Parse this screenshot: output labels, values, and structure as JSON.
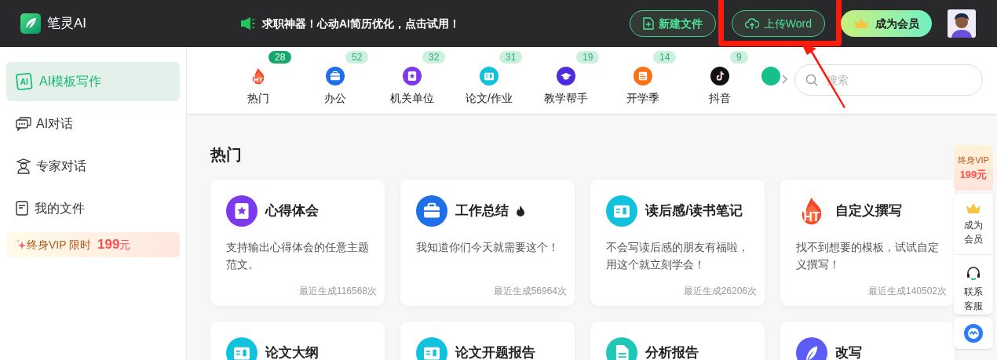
{
  "header": {
    "logo_text": "笔灵AI",
    "promo": "求职神器！心动AI简历优化，点击试用！",
    "buttons": [
      {
        "label": "新建文件",
        "kind": "new",
        "highlighted": false
      },
      {
        "label": "上传Word",
        "kind": "upload",
        "highlighted": true
      },
      {
        "label": "成为会员",
        "kind": "vip",
        "highlighted": false
      }
    ]
  },
  "sidebar": {
    "items": [
      {
        "label": "AI模板写作",
        "icon_text": "AI",
        "selected": true
      },
      {
        "label": "AI对话",
        "selected": false
      },
      {
        "label": "专家对话",
        "selected": false
      },
      {
        "label": "我的文件",
        "selected": false
      }
    ],
    "vip": {
      "label": "终身VIP 限时",
      "price": "199",
      "unit": "元"
    }
  },
  "categories": [
    {
      "label": "热门",
      "count": "28",
      "icon_text": "HT",
      "selected": true
    },
    {
      "label": "办公",
      "count": "52",
      "selected": false
    },
    {
      "label": "机关单位",
      "count": "32",
      "selected": false
    },
    {
      "label": "论文/作业",
      "count": "31",
      "selected": false
    },
    {
      "label": "教学帮手",
      "count": "19",
      "selected": false
    },
    {
      "label": "开学季",
      "count": "14",
      "selected": false
    },
    {
      "label": "抖音",
      "count": "9",
      "selected": false
    }
  ],
  "search": {
    "placeholder": "搜索"
  },
  "section_title": "热门",
  "cards": [
    {
      "title": "心得体会",
      "desc": "支持输出心得体会的任意主题范文。",
      "count": "最近生成116568次",
      "flame": false
    },
    {
      "title": "工作总结",
      "desc": "我知道你们今天就需要这个！",
      "count": "最近生成56964次",
      "flame": true
    },
    {
      "title": "读后感/读书笔记",
      "desc": "不会写读后感的朋友有福啦，用这个就立刻学会！",
      "count": "最近生成26206次",
      "flame": false
    },
    {
      "title": "自定义撰写",
      "icon_text": "HT",
      "desc": "找不到想要的模板，试试自定义撰写！",
      "count": "最近生成140502次",
      "flame": false
    },
    {
      "title": "论文大纲"
    },
    {
      "title": "论文开题报告"
    },
    {
      "title": "分析报告"
    },
    {
      "title": "改写"
    }
  ],
  "float_panel": {
    "vip_label": "终身VIP",
    "vip_price": "199元",
    "member": "成为会员",
    "service": "联系客服"
  }
}
